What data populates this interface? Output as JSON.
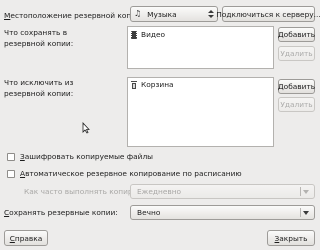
{
  "location": {
    "label_prefix": "М",
    "label_rest": "естоположение резервной копии:",
    "value": "Музыка",
    "icon": "music-note-icon",
    "connect_button": "Подключиться к серверу..."
  },
  "include": {
    "label": "Что сохранять в\nрезервной копии:",
    "items": [
      {
        "name": "Видео",
        "icon": "video-folder-icon"
      }
    ],
    "add_button": "Добавить",
    "remove_button": "Удалить"
  },
  "exclude": {
    "label": "Что исключить из\nрезервной копии:",
    "items": [
      {
        "name": "Корзина",
        "icon": "trash-icon"
      }
    ],
    "add_button": "Добавить",
    "remove_button": "Удалить"
  },
  "options": {
    "encrypt_prefix": "З",
    "encrypt_rest": "ашифровать копируемые файлы",
    "encrypt_checked": false,
    "schedule_prefix": "А",
    "schedule_rest": "втоматическое резервное копирование по расписанию",
    "schedule_checked": false
  },
  "frequency": {
    "label": "Как часто выполнять копирование:",
    "value": "Ежедневно"
  },
  "retention": {
    "label_prefix": "С",
    "label_rest": "охранять резервные копии:",
    "value": "Вечно"
  },
  "footer": {
    "help_prefix": "С",
    "help_rest": "правка",
    "close_prefix": "З",
    "close_rest": "акрыть"
  }
}
